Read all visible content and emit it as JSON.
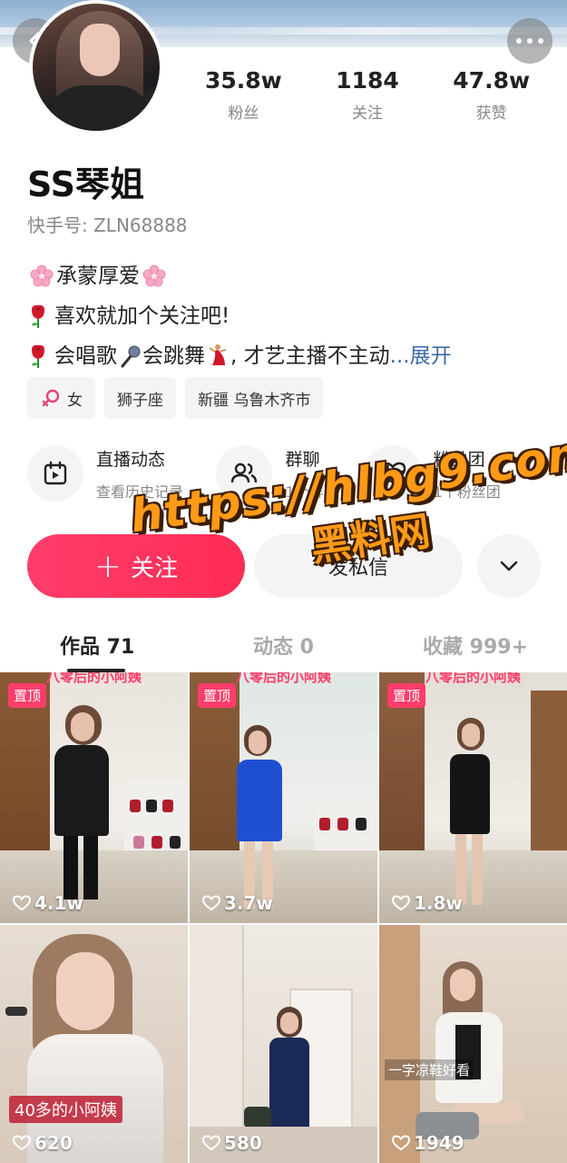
{
  "header": {
    "back_icon": "chevron-left-icon",
    "more_icon": "more-dots-icon"
  },
  "profile": {
    "name": "SS琴姐",
    "uid": "快手号: ZLN68888",
    "stats": [
      {
        "value": "35.8w",
        "label": "粉丝"
      },
      {
        "value": "1184",
        "label": "关注"
      },
      {
        "value": "47.8w",
        "label": "获赞"
      }
    ],
    "bio": {
      "line1": "承蒙厚爱",
      "line2": "喜欢就加个关注吧!",
      "line3_a": "会唱歌",
      "line3_b": "会跳舞",
      "line3_c": ", 才艺主播不主动",
      "line3_ellipsis": "...",
      "expand": "展开"
    },
    "tags": [
      "女",
      "狮子座",
      "新疆 乌鲁木齐市"
    ]
  },
  "features": [
    {
      "title": "直播动态",
      "subtitle": "查看历史记录",
      "icon": "calendar-play-icon"
    },
    {
      "title": "群聊",
      "subtitle": "1个群聊",
      "icon": "group-icon"
    },
    {
      "title": "粉丝团",
      "subtitle": "1个粉丝团",
      "icon": "heart-badge-icon"
    }
  ],
  "actions": {
    "follow": "关注",
    "message": "发私信"
  },
  "watermark": {
    "url": "https://hlbg9.com",
    "site": "黑料网"
  },
  "tabs": [
    {
      "label": "作品 71"
    },
    {
      "label": "动态 0"
    },
    {
      "label": "收藏 999+"
    }
  ],
  "videos": [
    {
      "likes": "4.1w",
      "pinned": "置顶",
      "caption": "八零后的小阿姨"
    },
    {
      "likes": "3.7w",
      "pinned": "置顶",
      "caption": "八零后的小阿姨"
    },
    {
      "likes": "1.8w",
      "pinned": "置顶",
      "caption": "八零后的小阿姨"
    },
    {
      "likes": "620",
      "caption": "40多的小阿姨"
    },
    {
      "likes": "580"
    },
    {
      "likes": "1949",
      "caption": "一字凉鞋好看"
    }
  ],
  "colors": {
    "accent": "#fe2c55",
    "watermark": "#ff9a16",
    "link": "#3d6aa8"
  }
}
